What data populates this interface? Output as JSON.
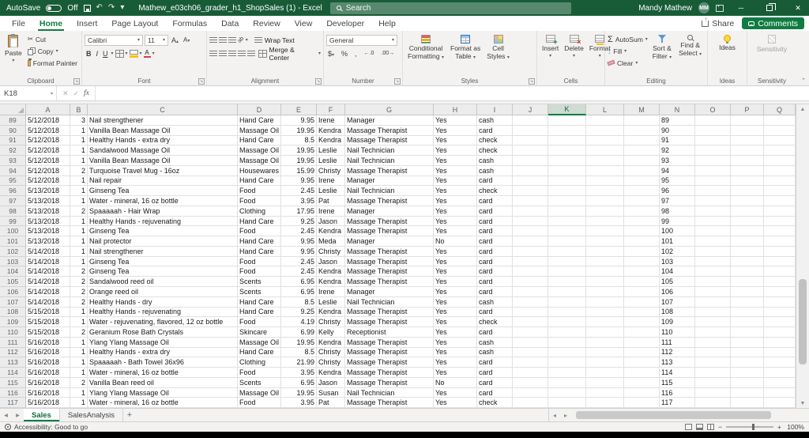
{
  "title_bar": {
    "autosave_label": "AutoSave",
    "autosave_state": "Off",
    "document_title": "Mathew_e03ch06_grader_h1_ShopSales (1) - Excel",
    "search_placeholder": "Search",
    "user_name": "Mandy Mathew",
    "user_initials": "MM"
  },
  "menu_bar": {
    "tabs": [
      "File",
      "Home",
      "Insert",
      "Page Layout",
      "Formulas",
      "Data",
      "Review",
      "View",
      "Developer",
      "Help"
    ],
    "active_tab": "Home",
    "share": "Share",
    "comments": "Comments"
  },
  "ribbon": {
    "clipboard": {
      "group": "Clipboard",
      "paste": "Paste",
      "cut": "Cut",
      "copy": "Copy",
      "format_painter": "Format Painter"
    },
    "font": {
      "group": "Font",
      "family": "Calibri",
      "size": "11",
      "bold": "B",
      "italic": "I",
      "underline": "U"
    },
    "alignment": {
      "group": "Alignment",
      "wrap_text": "Wrap Text",
      "merge_center": "Merge & Center"
    },
    "number": {
      "group": "Number",
      "format": "General",
      "currency": "$",
      "percent": "%",
      "comma": ",",
      "inc_decimal": "←.0",
      "dec_decimal": ".00→"
    },
    "styles": {
      "group": "Styles",
      "conditional_line1": "Conditional",
      "conditional_line2": "Formatting",
      "table_line1": "Format as",
      "table_line2": "Table",
      "cellstyles_line1": "Cell",
      "cellstyles_line2": "Styles"
    },
    "cells": {
      "group": "Cells",
      "insert": "Insert",
      "delete": "Delete",
      "format": "Format"
    },
    "editing": {
      "group": "Editing",
      "autosum": "AutoSum",
      "fill": "Fill",
      "clear": "Clear",
      "sort_line1": "Sort &",
      "sort_line2": "Filter",
      "find_line1": "Find &",
      "find_line2": "Select"
    },
    "ideas": {
      "group": "Ideas",
      "ideas": "Ideas"
    },
    "sensitivity": {
      "group": "Sensitivity",
      "sensitivity": "Sensitivity"
    }
  },
  "formula_bar": {
    "name_box": "K18",
    "fx": "fx",
    "formula": ""
  },
  "grid": {
    "columns": [
      "A",
      "B",
      "C",
      "D",
      "E",
      "F",
      "G",
      "H",
      "I",
      "J",
      "K",
      "L",
      "M",
      "N",
      "O",
      "P",
      "Q"
    ],
    "selected_column": "K",
    "rows": [
      {
        "n": 89,
        "a": "5/12/2018",
        "b": "3",
        "c": "Nail strengthener",
        "d": "Hand Care",
        "e": "9.95",
        "f": "Irene",
        "g": "Manager",
        "h": "Yes",
        "i": "cash"
      },
      {
        "n": 90,
        "a": "5/12/2018",
        "b": "1",
        "c": "Vanilla Bean Massage Oil",
        "d": "Massage Oil",
        "e": "19.95",
        "f": "Kendra",
        "g": "Massage Therapist",
        "h": "Yes",
        "i": "card"
      },
      {
        "n": 91,
        "a": "5/12/2018",
        "b": "1",
        "c": "Healthy Hands - extra dry",
        "d": "Hand Care",
        "e": "8.5",
        "f": "Kendra",
        "g": "Massage Therapist",
        "h": "Yes",
        "i": "check"
      },
      {
        "n": 92,
        "a": "5/12/2018",
        "b": "1",
        "c": "Sandalwood Massage Oil",
        "d": "Massage Oil",
        "e": "19.95",
        "f": "Leslie",
        "g": "Nail Technician",
        "h": "Yes",
        "i": "check"
      },
      {
        "n": 93,
        "a": "5/12/2018",
        "b": "1",
        "c": "Vanilla Bean Massage Oil",
        "d": "Massage Oil",
        "e": "19.95",
        "f": "Leslie",
        "g": "Nail Technician",
        "h": "Yes",
        "i": "cash"
      },
      {
        "n": 94,
        "a": "5/12/2018",
        "b": "2",
        "c": "Turquoise Travel Mug - 16oz",
        "d": "Housewares",
        "e": "15.99",
        "f": "Christy",
        "g": "Massage Therapist",
        "h": "Yes",
        "i": "cash"
      },
      {
        "n": 95,
        "a": "5/12/2018",
        "b": "1",
        "c": "Nail repair",
        "d": "Hand Care",
        "e": "9.95",
        "f": "Irene",
        "g": "Manager",
        "h": "Yes",
        "i": "card"
      },
      {
        "n": 96,
        "a": "5/13/2018",
        "b": "1",
        "c": "Ginseng Tea",
        "d": "Food",
        "e": "2.45",
        "f": "Leslie",
        "g": "Nail Technician",
        "h": "Yes",
        "i": "check"
      },
      {
        "n": 97,
        "a": "5/13/2018",
        "b": "1",
        "c": "Water - mineral, 16 oz bottle",
        "d": "Food",
        "e": "3.95",
        "f": "Pat",
        "g": "Massage Therapist",
        "h": "Yes",
        "i": "card"
      },
      {
        "n": 98,
        "a": "5/13/2018",
        "b": "2",
        "c": "Spaaaaah - Hair Wrap",
        "d": "Clothing",
        "e": "17.95",
        "f": "Irene",
        "g": "Manager",
        "h": "Yes",
        "i": "card"
      },
      {
        "n": 99,
        "a": "5/13/2018",
        "b": "1",
        "c": "Healthy Hands - rejuvenating",
        "d": "Hand Care",
        "e": "9.25",
        "f": "Jason",
        "g": "Massage Therapist",
        "h": "Yes",
        "i": "card"
      },
      {
        "n": 100,
        "a": "5/13/2018",
        "b": "1",
        "c": "Ginseng Tea",
        "d": "Food",
        "e": "2.45",
        "f": "Kendra",
        "g": "Massage Therapist",
        "h": "Yes",
        "i": "card"
      },
      {
        "n": 101,
        "a": "5/13/2018",
        "b": "1",
        "c": "Nail protector",
        "d": "Hand Care",
        "e": "9.95",
        "f": "Meda",
        "g": "Manager",
        "h": "No",
        "i": "card"
      },
      {
        "n": 102,
        "a": "5/14/2018",
        "b": "1",
        "c": "Nail strengthener",
        "d": "Hand Care",
        "e": "9.95",
        "f": "Christy",
        "g": "Massage Therapist",
        "h": "Yes",
        "i": "card"
      },
      {
        "n": 103,
        "a": "5/14/2018",
        "b": "1",
        "c": "Ginseng Tea",
        "d": "Food",
        "e": "2.45",
        "f": "Jason",
        "g": "Massage Therapist",
        "h": "Yes",
        "i": "card"
      },
      {
        "n": 104,
        "a": "5/14/2018",
        "b": "2",
        "c": "Ginseng Tea",
        "d": "Food",
        "e": "2.45",
        "f": "Kendra",
        "g": "Massage Therapist",
        "h": "Yes",
        "i": "card"
      },
      {
        "n": 105,
        "a": "5/14/2018",
        "b": "2",
        "c": "Sandalwood reed oil",
        "d": "Scents",
        "e": "6.95",
        "f": "Kendra",
        "g": "Massage Therapist",
        "h": "Yes",
        "i": "card"
      },
      {
        "n": 106,
        "a": "5/14/2018",
        "b": "2",
        "c": "Orange reed oil",
        "d": "Scents",
        "e": "6.95",
        "f": "Irene",
        "g": "Manager",
        "h": "Yes",
        "i": "card"
      },
      {
        "n": 107,
        "a": "5/14/2018",
        "b": "2",
        "c": "Healthy Hands - dry",
        "d": "Hand Care",
        "e": "8.5",
        "f": "Leslie",
        "g": "Nail Technician",
        "h": "Yes",
        "i": "cash"
      },
      {
        "n": 108,
        "a": "5/15/2018",
        "b": "1",
        "c": "Healthy Hands - rejuvenating",
        "d": "Hand Care",
        "e": "9.25",
        "f": "Kendra",
        "g": "Massage Therapist",
        "h": "Yes",
        "i": "card"
      },
      {
        "n": 109,
        "a": "5/15/2018",
        "b": "1",
        "c": "Water - rejuvenating, flavored, 12 oz bottle",
        "d": "Food",
        "e": "4.19",
        "f": "Christy",
        "g": "Massage Therapist",
        "h": "Yes",
        "i": "check"
      },
      {
        "n": 110,
        "a": "5/15/2018",
        "b": "2",
        "c": "Geranium Rose Bath Crystals",
        "d": "Skincare",
        "e": "6.99",
        "f": "Kelly",
        "g": "Receptionist",
        "h": "Yes",
        "i": "card"
      },
      {
        "n": 111,
        "a": "5/16/2018",
        "b": "1",
        "c": "Ylang Ylang Massage Oil",
        "d": "Massage Oil",
        "e": "19.95",
        "f": "Kendra",
        "g": "Massage Therapist",
        "h": "Yes",
        "i": "cash"
      },
      {
        "n": 112,
        "a": "5/16/2018",
        "b": "1",
        "c": "Healthy Hands - extra dry",
        "d": "Hand Care",
        "e": "8.5",
        "f": "Christy",
        "g": "Massage Therapist",
        "h": "Yes",
        "i": "cash"
      },
      {
        "n": 113,
        "a": "5/16/2018",
        "b": "1",
        "c": "Spaaaaah - Bath Towel 36x96",
        "d": "Clothing",
        "e": "21.99",
        "f": "Christy",
        "g": "Massage Therapist",
        "h": "Yes",
        "i": "card"
      },
      {
        "n": 114,
        "a": "5/16/2018",
        "b": "1",
        "c": "Water - mineral, 16 oz bottle",
        "d": "Food",
        "e": "3.95",
        "f": "Kendra",
        "g": "Massage Therapist",
        "h": "Yes",
        "i": "card"
      },
      {
        "n": 115,
        "a": "5/16/2018",
        "b": "2",
        "c": "Vanilla Bean reed oil",
        "d": "Scents",
        "e": "6.95",
        "f": "Jason",
        "g": "Massage Therapist",
        "h": "No",
        "i": "card"
      },
      {
        "n": 116,
        "a": "5/16/2018",
        "b": "1",
        "c": "Ylang Ylang Massage Oil",
        "d": "Massage Oil",
        "e": "19.95",
        "f": "Susan",
        "g": "Nail Technician",
        "h": "Yes",
        "i": "card"
      },
      {
        "n": 117,
        "a": "5/16/2018",
        "b": "1",
        "c": "Water - mineral, 16 oz bottle",
        "d": "Food",
        "e": "3.95",
        "f": "Pat",
        "g": "Massage Therapist",
        "h": "Yes",
        "i": "check"
      }
    ]
  },
  "sheet_bar": {
    "tabs": [
      {
        "label": "Sales",
        "active": true
      },
      {
        "label": "SalesAnalysis",
        "active": false
      }
    ]
  },
  "status_bar": {
    "accessibility": "Accessibility: Good to go",
    "zoom": "100%"
  },
  "colors": {
    "brand_green": "#107c41",
    "title_green": "#185c37"
  }
}
